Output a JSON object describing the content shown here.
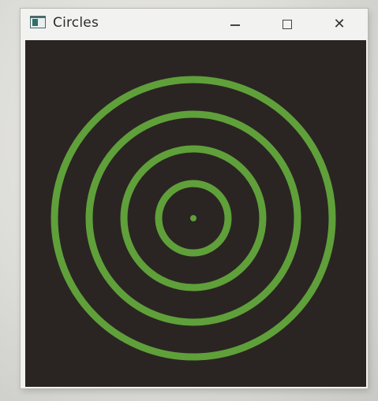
{
  "window": {
    "title": "Circles",
    "icon": "app-window-icon",
    "controls": {
      "minimize_icon": "minimize-icon",
      "maximize_icon": "maximize-icon",
      "close_icon": "close-icon",
      "close_glyph": "✕"
    }
  },
  "canvas": {
    "background_color": "#2a2522",
    "ring_color": "#5fa03a",
    "ring_count": 4,
    "center_dot": true
  }
}
